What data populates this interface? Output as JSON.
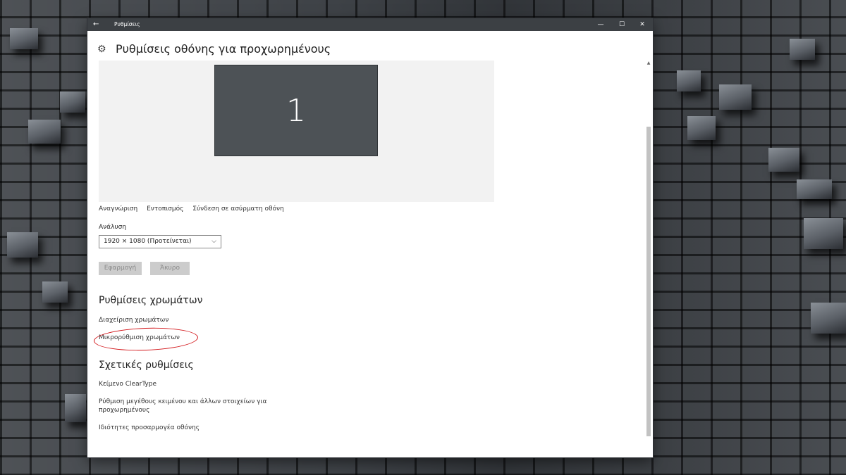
{
  "window": {
    "title": "Ρυθμίσεις",
    "back_icon": "back-arrow-icon",
    "minimize_glyph": "—",
    "maximize_glyph": "☐",
    "close_glyph": "✕"
  },
  "page": {
    "title": "Ρυθμίσεις οθόνης για προχωρημένους",
    "icon": "gear-icon"
  },
  "display": {
    "monitor_label": "1"
  },
  "display_links": [
    "Αναγνώριση",
    "Εντοπισμός",
    "Σύνδεση σε ασύρματη οθόνη"
  ],
  "resolution": {
    "label": "Ανάλυση",
    "value": "1920 × 1080 (Προτείνεται)"
  },
  "buttons": {
    "apply": "Εφαρμογή",
    "cancel": "Άκυρο"
  },
  "color_settings": {
    "heading": "Ρυθμίσεις χρωμάτων",
    "color_management": "Διαχείριση χρωμάτων",
    "color_calibration": "Μικρορύθμιση χρωμάτων"
  },
  "related": {
    "heading": "Σχετικές ρυθμίσεις",
    "cleartype": "Κείμενο ClearType",
    "text_size_line1": "Ρύθμιση μεγέθους κειμένου και άλλων στοιχείων για",
    "text_size_line2": "προχωρημένους",
    "adapter_properties": "Ιδιότητες προσαρμογέα οθόνης"
  },
  "colors": {
    "titlebar": "#3c4044",
    "monitor": "#4d5256",
    "annotation": "#d3181c"
  }
}
